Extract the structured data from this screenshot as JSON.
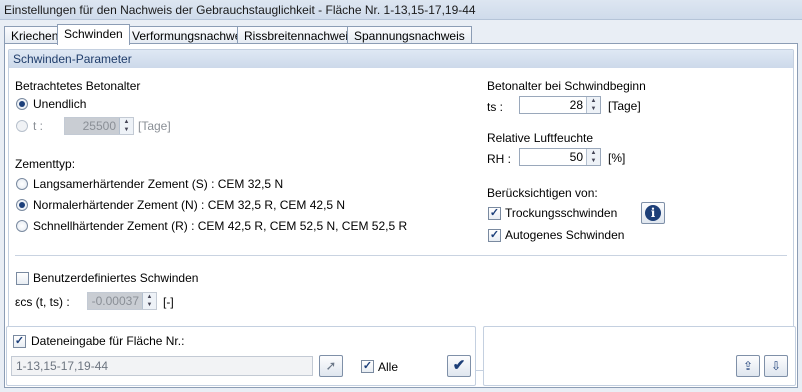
{
  "window": {
    "title": "Einstellungen für den Nachweis der Gebrauchstauglichkeit - Fläche Nr. 1-13,15-17,19-44"
  },
  "tabs": [
    {
      "label": "Kriechen"
    },
    {
      "label": "Schwinden"
    },
    {
      "label": "Verformungsnachweis"
    },
    {
      "label": "Rissbreitennachweis"
    },
    {
      "label": "Spannungsnachweis"
    }
  ],
  "group": {
    "title": "Schwinden-Parameter"
  },
  "concrete_age": {
    "label": "Betrachtetes Betonalter",
    "infinite_label": "Unendlich",
    "t_label": "t :",
    "t_value": "25500",
    "t_unit": "[Tage]"
  },
  "cement": {
    "label": "Zementtyp:",
    "options": [
      "Langsamerhärtender Zement (S) : CEM 32,5 N",
      "Normalerhärtender Zement (N) : CEM 32,5 R, CEM 42,5 N",
      "Schnellhärtender Zement (R) : CEM 42,5 R, CEM 52,5 N, CEM 52,5 R"
    ],
    "selected": "Normalerhärtender Zement (N) : CEM 32,5 R, CEM 42,5 N"
  },
  "shrink_start": {
    "label": "Betonalter bei Schwindbeginn",
    "ts_label": "ts :",
    "ts_value": "28",
    "ts_unit": "[Tage]"
  },
  "humidity": {
    "label": "Relative Luftfeuchte",
    "rh_label": "RH :",
    "rh_value": "50",
    "rh_unit": "[%]"
  },
  "consider": {
    "label": "Berücksichtigen von:",
    "drying_label": "Trockungsschwinden",
    "drying_checked": true,
    "autogenous_label": "Autogenes Schwinden",
    "autogenous_checked": true
  },
  "user_defined": {
    "label": "Benutzerdefiniertes Schwinden",
    "checked": false,
    "eps_label": "εcs (t, ts) :",
    "eps_value": "-0.00037",
    "eps_unit": "[-]"
  },
  "data_input": {
    "label": "Dateneingabe für Fläche Nr.:",
    "checked": true,
    "value": "1-13,15-17,19-44",
    "all_label": "Alle",
    "all_checked": true
  },
  "icons": {
    "info": "info-icon",
    "pick": "select-pointer-icon",
    "apply": "checkmark-icon",
    "export": "export-icon",
    "import": "import-icon"
  }
}
